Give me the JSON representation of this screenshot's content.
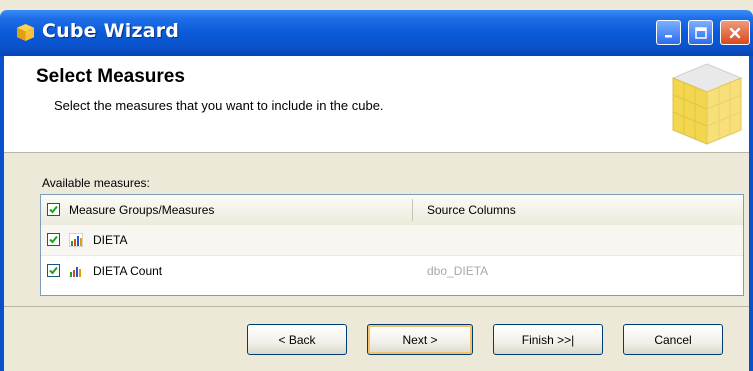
{
  "window": {
    "title": "Cube Wizard",
    "icon": "cube-icon",
    "controls": [
      "minimize-icon",
      "maximize-icon",
      "close-icon"
    ]
  },
  "header": {
    "title": "Select Measures",
    "subtitle": "Select the measures that you want to include in the cube.",
    "graphic": "cube-graphic"
  },
  "measures": {
    "label": "Available measures:",
    "columns": [
      "Measure Groups/Measures",
      "Source Columns"
    ],
    "header_checked": true,
    "rows": [
      {
        "name": "DIETA",
        "source": "",
        "checked": true,
        "icon": "measure-group-icon"
      },
      {
        "name": "DIETA Count",
        "source": "dbo_DIETA",
        "checked": true,
        "icon": "measure-icon"
      }
    ]
  },
  "buttons": {
    "back": "< Back",
    "next": "Next >",
    "finish": "Finish >>|",
    "cancel": "Cancel"
  },
  "colors": {
    "titlebar": "#0a52cc",
    "dialog_bg": "#ece9d8",
    "accent_check": "#21a121"
  }
}
